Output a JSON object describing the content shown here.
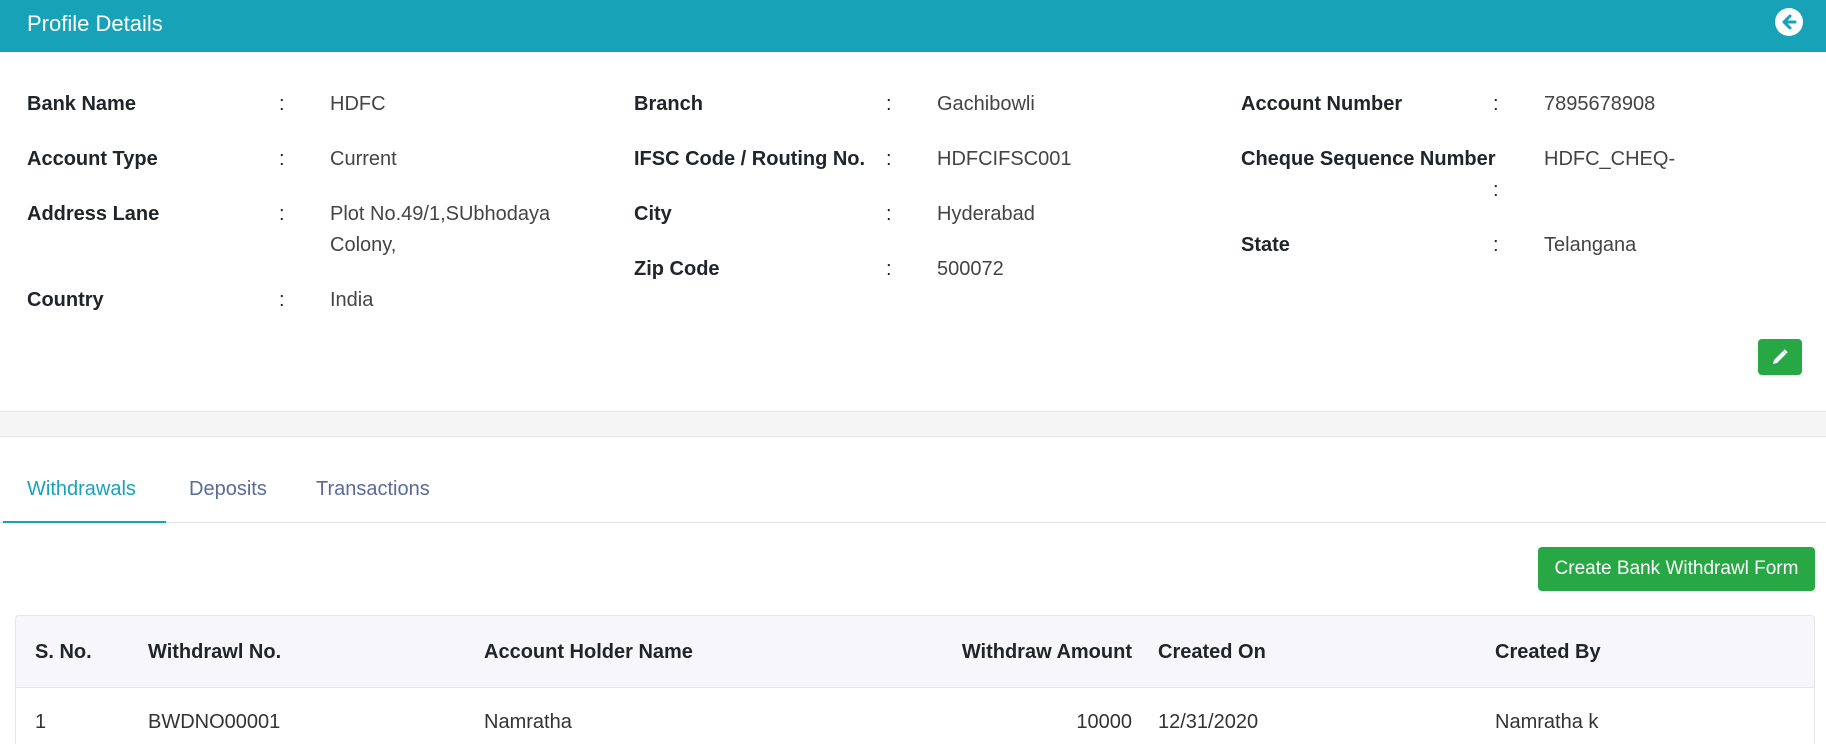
{
  "header": {
    "title": "Profile Details",
    "back_icon": "arrow-left-circle-icon"
  },
  "profile": {
    "bank_name": {
      "label": "Bank Name",
      "value": "HDFC"
    },
    "branch": {
      "label": "Branch",
      "value": "Gachibowli"
    },
    "account_number": {
      "label": "Account Number",
      "value": "7895678908"
    },
    "account_type": {
      "label": "Account Type",
      "value": "Current"
    },
    "ifsc": {
      "label": "IFSC Code / Routing No.",
      "value": "HDFCIFSC001"
    },
    "cheque_seq": {
      "label": "Cheque Sequence Number",
      "value": "HDFC_CHEQ-"
    },
    "address": {
      "label": "Address Lane",
      "value_line1": "Plot No.49/1,SUbhodaya",
      "value_line2": "Colony,"
    },
    "city": {
      "label": "City",
      "value": "Hyderabad"
    },
    "state": {
      "label": "State",
      "value": "Telangana"
    },
    "zip": {
      "label": "Zip Code",
      "value": "500072"
    },
    "country": {
      "label": "Country",
      "value": "India"
    },
    "colon": ":",
    "edit_icon": "pencil-icon"
  },
  "tabs": [
    {
      "label": "Withdrawals",
      "active": true
    },
    {
      "label": "Deposits",
      "active": false
    },
    {
      "label": "Transactions",
      "active": false
    }
  ],
  "create_button": {
    "label": "Create Bank Withdrawl Form"
  },
  "table": {
    "columns": [
      "S. No.",
      "Withdrawl No.",
      "Account Holder Name",
      "Withdraw Amount",
      "Created On",
      "Created By"
    ],
    "rows": [
      [
        "1",
        "BWDNO00001",
        "Namratha",
        "10000",
        "12/31/2020",
        "Namratha k"
      ]
    ]
  },
  "colors": {
    "header": "#17a2b8",
    "accent_green": "#28a745",
    "tab_active": "#17a2b8"
  }
}
